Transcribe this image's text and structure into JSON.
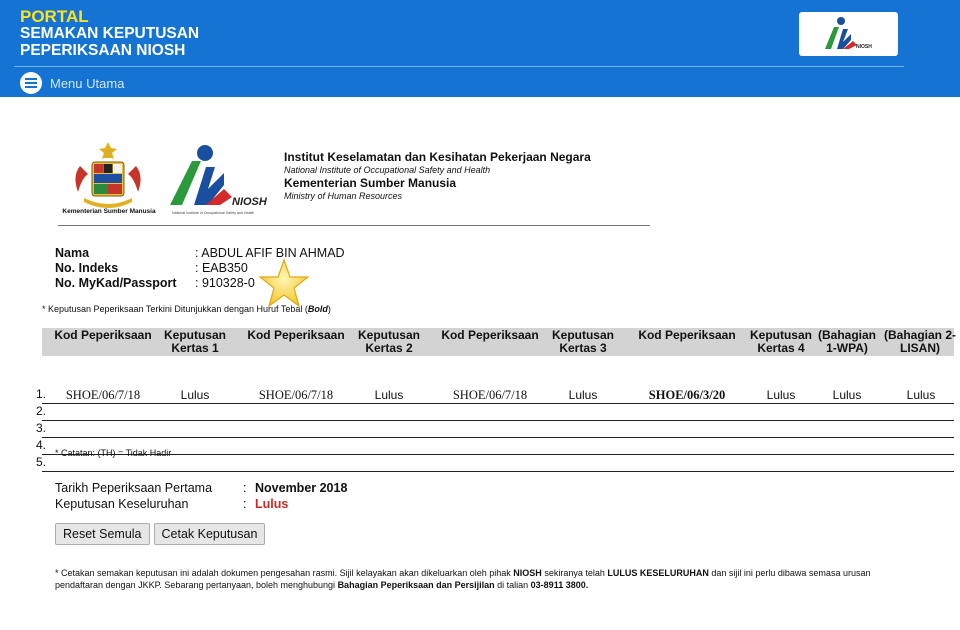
{
  "header": {
    "portal_line1": "PORTAL",
    "portal_line2": "SEMAKAN KEPUTUSAN",
    "portal_line3": "PEPERIKSAAN NIOSH",
    "menu_label": "Menu Utama",
    "logo_caption": "NIOSH"
  },
  "letterhead": {
    "crest_caption": "Kementerian Sumber Manusia",
    "niosh_text": "NIOSH",
    "niosh_sub": "National Institute of Occupational Safety and Health",
    "inst_name": "Institut Keselamatan dan Kesihatan Pekerjaan Negara",
    "inst_name_en": "National Institute of Occupational Safety and Health",
    "ministry": "Kementerian Sumber Manusia",
    "ministry_en": "Ministry of Human Resources"
  },
  "candidate": {
    "name_label": "Nama",
    "name_value": ": ABDUL AFIF BIN AHMAD",
    "index_label": "No. Indeks",
    "index_value": ": EAB350",
    "id_label": "No. MyKad/Passport",
    "id_value": ": 910328-0"
  },
  "note_bold": {
    "prefix": "* Keputusan Peperiksaan Terkini Ditunjukkan dengan Huruf Tebal (",
    "bold_word": "Bold",
    "suffix": ")"
  },
  "table": {
    "headers": [
      "Kod Peperiksaan",
      "Keputusan Kertas 1",
      "Kod Peperiksaan",
      "Keputusan Kertas 2",
      "Kod Peperiksaan",
      "Keputusan Kertas 3",
      "Kod Peperiksaan",
      "Keputusan Kertas 4",
      "(Bahagian 1-WPA)",
      "(Bahagian 2-LISAN)"
    ],
    "row_numbers": [
      "1.",
      "2.",
      "3.",
      "4.",
      "5."
    ],
    "row1": [
      "SHOE/06/7/18",
      "Lulus",
      "SHOE/06/7/18",
      "Lulus",
      "SHOE/06/7/18",
      "Lulus",
      "SHOE/06/3/20",
      "Lulus",
      "Lulus",
      "Lulus"
    ]
  },
  "catatan": "* Catatan: (TH) = Tidak Hadir",
  "summary": {
    "first_exam_label": "Tarikh Peperiksaan Pertama",
    "first_exam_value": "November 2018",
    "overall_label": "Keputusan Keseluruhan",
    "overall_value": "Lulus",
    "colon": ":"
  },
  "buttons": {
    "reset": "Reset Semula",
    "print": "Cetak Keputusan"
  },
  "footer": {
    "t1": "* Cetakan semakan keputusan ini adalah dokumen pengesahan rasmi. Sijil kelayakan akan dikeluarkan oleh pihak ",
    "b1": "NIOSH",
    "t2": " sekiranya telah ",
    "b2": "LULUS KESELURUHAN",
    "t3": " dan sijil ini perlu dibawa semasa urusan pendaftaran dengan JKKP. Sebarang pertanyaan, boleh menghubungi ",
    "b3": "Bahagian Peperiksaan dan Persijilan",
    "t4": " di talian ",
    "b4": "03-8911 3800."
  },
  "colors": {
    "banner_blue": "#1473d3",
    "portal_yellow": "#ffe21a",
    "pass_red": "#cc2a1f",
    "header_gray": "#d3d3d3"
  }
}
